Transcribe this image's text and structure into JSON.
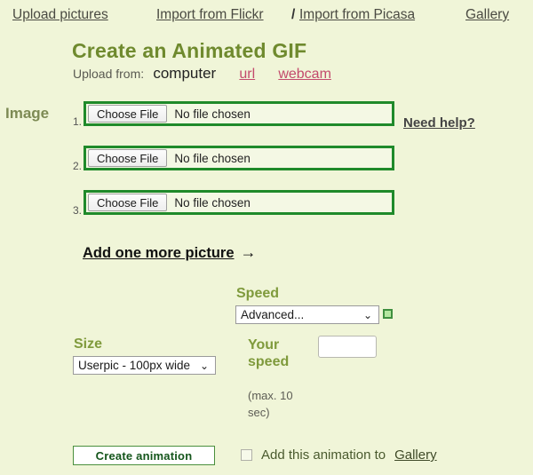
{
  "nav": {
    "upload_pictures": "Upload pictures",
    "import_flickr": "Import from Flickr",
    "separator": "/",
    "import_picasa": "Import from Picasa",
    "gallery": "Gallery"
  },
  "header": {
    "title": "Create an Animated GIF",
    "upload_from_label": "Upload from:",
    "upload_from_current": "computer",
    "upload_from_url": "url",
    "upload_from_webcam": "webcam"
  },
  "image_section": {
    "label": "Image",
    "need_help": "Need help?",
    "add_more_text": "Add one more picture",
    "add_more_arrow": "→",
    "rows": [
      {
        "number": "1.",
        "button_label": "Choose File",
        "status": "No file chosen"
      },
      {
        "number": "2.",
        "button_label": "Choose File",
        "status": "No file chosen"
      },
      {
        "number": "3.",
        "button_label": "Choose File",
        "status": "No file chosen"
      }
    ]
  },
  "speed": {
    "label": "Speed",
    "selected": "Advanced...",
    "chevron": "⌄",
    "swatch_color": "#b5e6a0"
  },
  "size": {
    "label": "Size",
    "selected": "Userpic - 100px wide",
    "chevron": "⌄"
  },
  "your_speed": {
    "label": "Your speed",
    "note": "(max. 10 sec)",
    "value": "",
    "placeholder": ""
  },
  "footer": {
    "create_button": "Create animation",
    "gallery_checkbox_text": "Add this animation to",
    "gallery_link": "Gallery",
    "checked": false
  },
  "colors": {
    "page_background": "#f0f5d8",
    "heading_green": "#6f8a2e",
    "label_green": "#7f9a3c",
    "link_pink": "#c34a6c",
    "input_border_green": "#1f8a2a",
    "button_text_green": "#14551b"
  }
}
